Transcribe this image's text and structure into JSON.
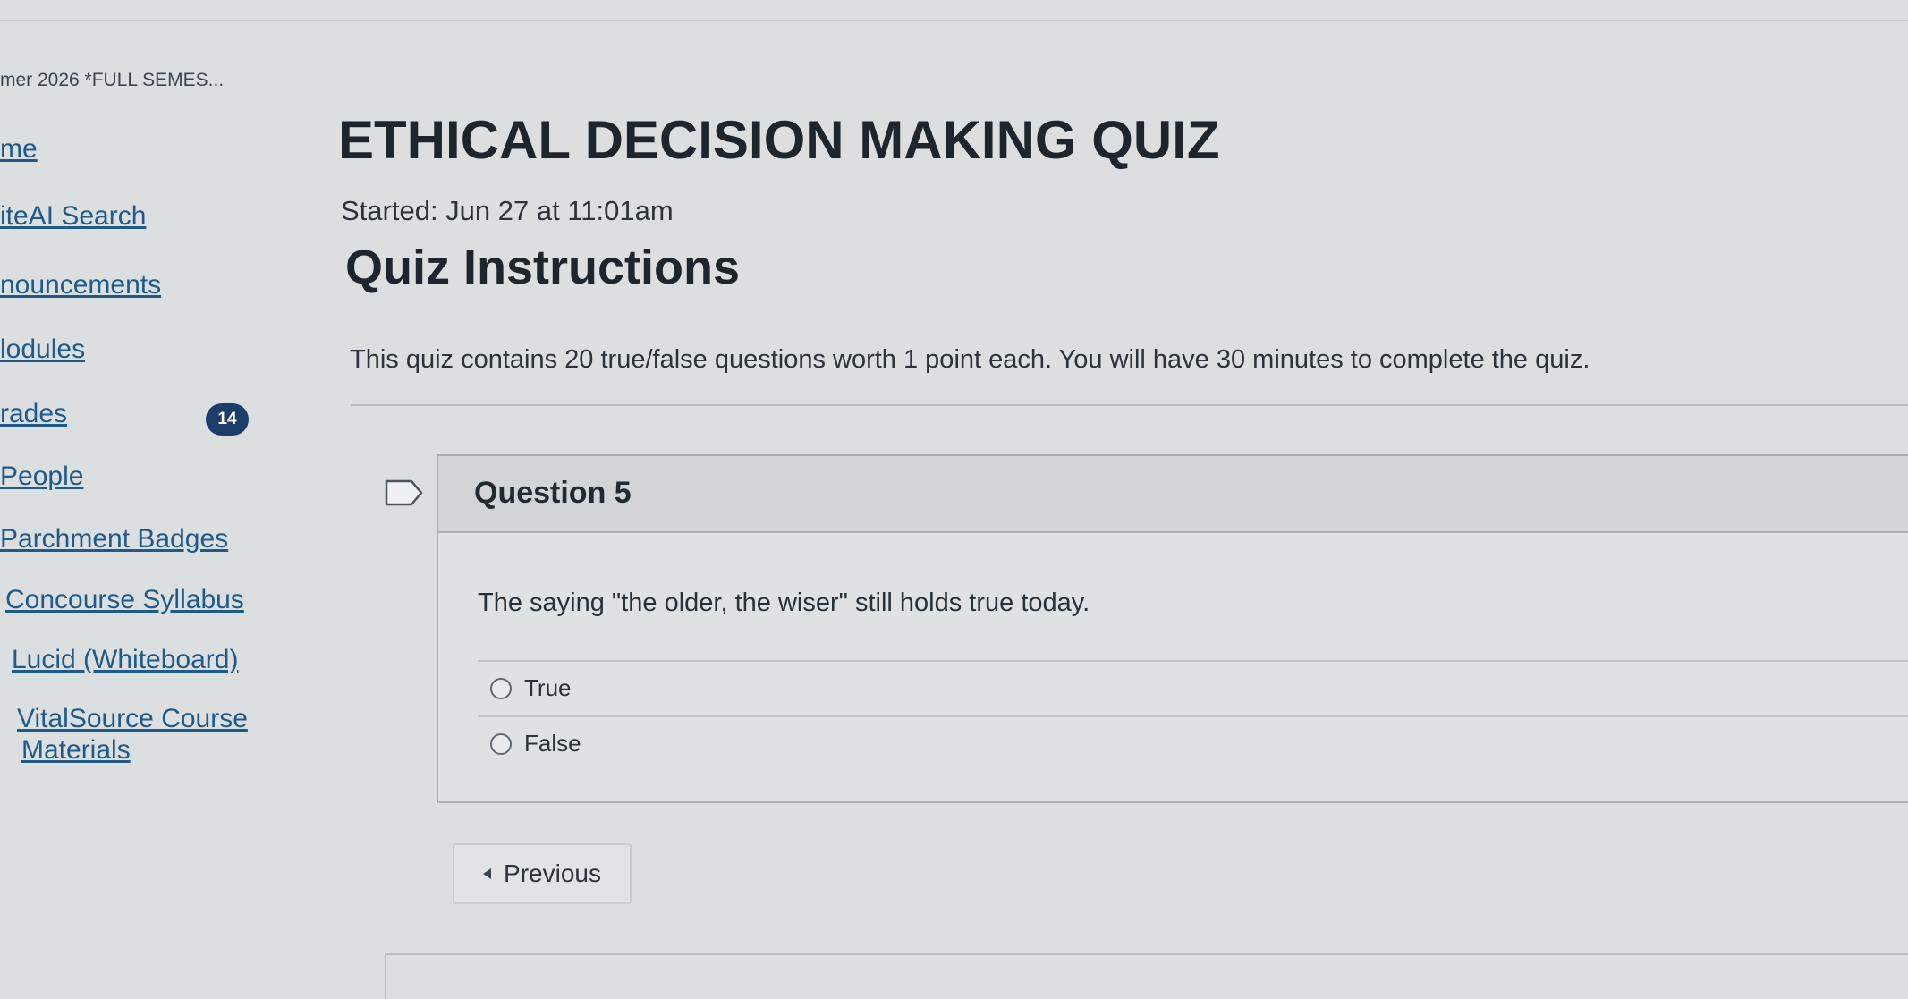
{
  "course": {
    "crumb": "mer 2026 *FULL SEMES..."
  },
  "nav": {
    "items": [
      {
        "label": "me"
      },
      {
        "label": "iteAI Search"
      },
      {
        "label": "nouncements"
      },
      {
        "label": "lodules"
      },
      {
        "label": "rades"
      },
      {
        "label": "People"
      },
      {
        "label": "Parchment Badges"
      },
      {
        "label": "Concourse Syllabus"
      },
      {
        "label": "Lucid (Whiteboard)"
      },
      {
        "label": "VitalSource Course"
      },
      {
        "label": "Materials"
      }
    ],
    "grades_badge": "14"
  },
  "quiz": {
    "title": "ETHICAL DECISION MAKING QUIZ",
    "started": "Started: Jun 27 at 11:01am",
    "instructions_heading": "Quiz Instructions",
    "instructions_text": "This quiz contains 20 true/false questions worth 1 point each. You will have 30 minutes to complete the quiz."
  },
  "question": {
    "title": "Question 5",
    "text": "The saying \"the older, the wiser\" still holds true today.",
    "answers": [
      {
        "label": "True"
      },
      {
        "label": "False"
      }
    ]
  },
  "navigation": {
    "previous_label": "Previous"
  }
}
